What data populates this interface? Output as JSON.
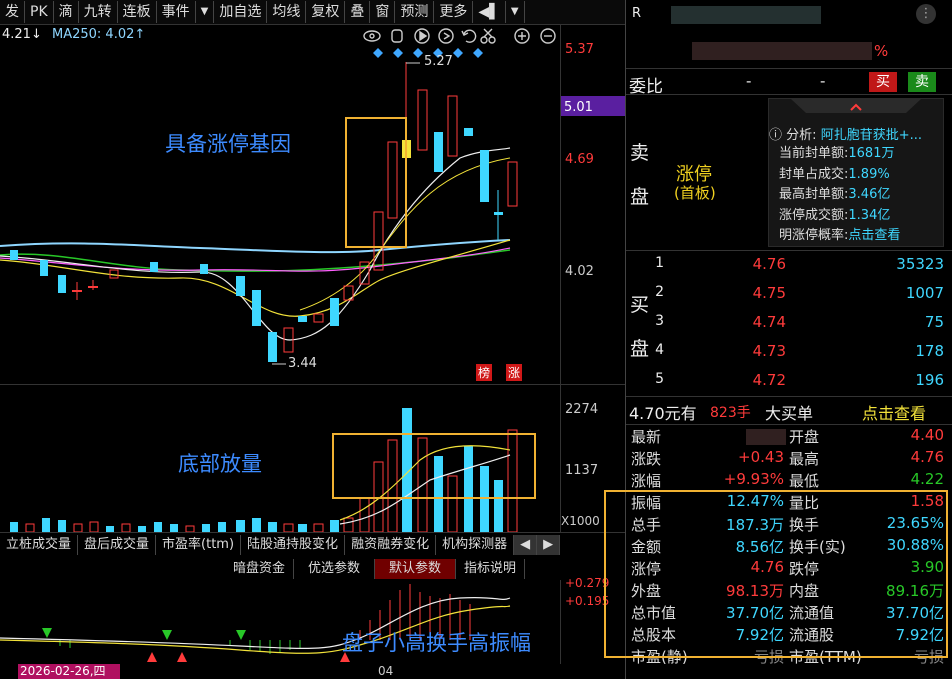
{
  "toolbar": {
    "items": [
      "发",
      "PK",
      "滴",
      "九转",
      "连板",
      "事件",
      "▼",
      "加自选",
      "均线",
      "复权",
      "叠",
      "窗",
      "预测",
      "更多",
      "◀▌",
      "▼"
    ]
  },
  "kline": {
    "ma_label_left": "4.21↓",
    "ma250": "MA250: 4.02↑",
    "price_labels": [
      "5.37",
      "5.01",
      "4.69",
      "4.02"
    ],
    "high_mark": "5.27",
    "low_mark": "3.44",
    "badges": [
      "榜",
      "涨"
    ],
    "annotation": "具备涨停基因",
    "tool_icons": [
      "eye-icon",
      "hand-icon",
      "play-icon",
      "play-circle-icon",
      "undo-icon",
      "scissors-icon",
      "plus-circle-icon",
      "minus-circle-icon"
    ]
  },
  "volume": {
    "labels": [
      "2274",
      "1137",
      "X1000"
    ],
    "annotation": "底部放量"
  },
  "tabs1": [
    "立桩成交量",
    "盘后成交量",
    "市盈率(ttm)",
    "陆股通持股变化",
    "融资融券变化",
    "机构探测器"
  ],
  "tabs2": [
    "暗盘资金",
    "优选参数",
    "默认参数",
    "指标说明"
  ],
  "indicator": {
    "labels": [
      "+0.279",
      "+0.195"
    ],
    "annotation": "盘子小高换手高振幅",
    "date": "2026-02-26,四",
    "tick": "04"
  },
  "colors": {
    "red": "#ff3b3b",
    "cyan": "#3fd7ff",
    "green": "#28c828",
    "yellow": "#f2e23a",
    "orange": "#f0b232",
    "blue": "#3d8bff"
  },
  "right": {
    "header_r": "R",
    "header_pct": "%",
    "weibi": "委比",
    "dash1": "-",
    "dash2": "-",
    "buy": "买",
    "sell": "卖",
    "sell_panel_v": [
      "卖",
      "盘"
    ],
    "limit_up": "涨停",
    "limit_sub": "(首板)",
    "analysis_lbl": "分析:",
    "analysis_val": "阿扎胞苷获批+...",
    "stats": [
      {
        "k": "当前封单额:",
        "v": "1681万"
      },
      {
        "k": "封单占成交:",
        "v": "1.89%"
      },
      {
        "k": "最高封单额:",
        "v": "3.46亿"
      },
      {
        "k": "涨停成交额:",
        "v": "1.34亿"
      },
      {
        "k": "明涨停概率:",
        "v": "点击查看"
      }
    ],
    "buy_panel_v": [
      "买",
      "盘"
    ],
    "buy_rows": [
      {
        "n": "1",
        "p": "4.76",
        "v": "35323"
      },
      {
        "n": "2",
        "p": "4.75",
        "v": "1007"
      },
      {
        "n": "3",
        "p": "4.74",
        "v": "75"
      },
      {
        "n": "4",
        "p": "4.73",
        "v": "178"
      },
      {
        "n": "5",
        "p": "4.72",
        "v": "196"
      }
    ],
    "bigbuy": {
      "a": "4.70元有",
      "b": "823手",
      "c": "大买单",
      "d": "点击查看"
    },
    "quote_rows": [
      {
        "l1": "最新",
        "v1": "",
        "l2": "开盘",
        "v2": "4.40"
      },
      {
        "l1": "涨跌",
        "v1": "+0.43",
        "l2": "最高",
        "v2": "4.76"
      },
      {
        "l1": "涨幅",
        "v1": "+9.93%",
        "l2": "最低",
        "v2": "4.22"
      },
      {
        "l1": "振幅",
        "v1": "12.47%",
        "l2": "量比",
        "v2": "1.58"
      },
      {
        "l1": "总手",
        "v1": "187.3万",
        "l2": "换手",
        "v2": "23.65%"
      },
      {
        "l1": "金额",
        "v1": "8.56亿",
        "l2": "换手(实)",
        "v2": "30.88%"
      },
      {
        "l1": "涨停",
        "v1": "4.76",
        "l2": "跌停",
        "v2": "3.90"
      },
      {
        "l1": "外盘",
        "v1": "98.13万",
        "l2": "内盘",
        "v2": "89.16万"
      },
      {
        "l1": "总市值",
        "v1": "37.70亿",
        "l2": "流通值",
        "v2": "37.70亿"
      },
      {
        "l1": "总股本",
        "v1": "7.92亿",
        "l2": "流通股",
        "v2": "7.92亿"
      },
      {
        "l1": "市盈(静)",
        "v1": "亏损",
        "l2": "市盈(TTM)",
        "v2": "亏损"
      }
    ]
  }
}
